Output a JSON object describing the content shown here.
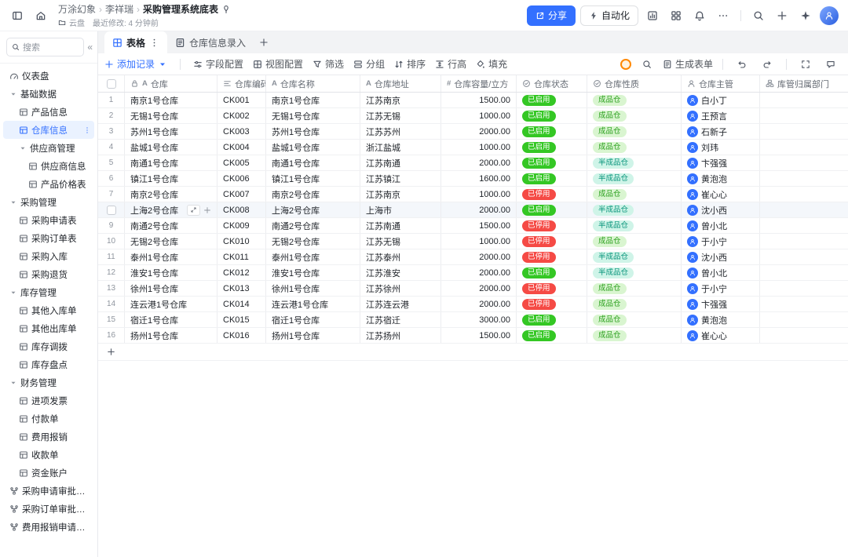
{
  "colors": {
    "accent": "#3370FF",
    "status_enabled": "#34C724",
    "status_disabled": "#F54A45",
    "nature_finished_bg": "#D9F5D0",
    "nature_finished_text": "#2EA121",
    "nature_semi_bg": "#CFF4E8",
    "nature_semi_text": "#0A957C"
  },
  "topbar": {
    "breadcrumb": [
      "万涂幻象",
      "李祥瑞",
      "采购管理系统底表"
    ],
    "drive_label": "云盘",
    "modified_label": "最近修改: 4 分钟前",
    "share_label": "分享",
    "automation_label": "自动化"
  },
  "sidebar": {
    "search_placeholder": "搜索",
    "items": [
      {
        "label": "仪表盘",
        "level": 0,
        "type": "leaf",
        "icon": "gauge"
      },
      {
        "label": "基础数据",
        "level": 0,
        "type": "group"
      },
      {
        "label": "产品信息",
        "level": 1,
        "type": "leaf",
        "icon": "tableicon"
      },
      {
        "label": "仓库信息",
        "level": 1,
        "type": "leaf",
        "icon": "tableicon",
        "active": true
      },
      {
        "label": "供应商管理",
        "level": 1,
        "type": "group"
      },
      {
        "label": "供应商信息",
        "level": 2,
        "type": "leaf",
        "icon": "tableicon"
      },
      {
        "label": "产品价格表",
        "level": 2,
        "type": "leaf",
        "icon": "tableicon"
      },
      {
        "label": "采购管理",
        "level": 0,
        "type": "group"
      },
      {
        "label": "采购申请表",
        "level": 1,
        "type": "leaf",
        "icon": "tableicon"
      },
      {
        "label": "采购订单表",
        "level": 1,
        "type": "leaf",
        "icon": "tableicon"
      },
      {
        "label": "采购入库",
        "level": 1,
        "type": "leaf",
        "icon": "tableicon"
      },
      {
        "label": "采购退货",
        "level": 1,
        "type": "leaf",
        "icon": "tableicon"
      },
      {
        "label": "库存管理",
        "level": 0,
        "type": "group"
      },
      {
        "label": "其他入库单",
        "level": 1,
        "type": "leaf",
        "icon": "tableicon"
      },
      {
        "label": "其他出库单",
        "level": 1,
        "type": "leaf",
        "icon": "tableicon"
      },
      {
        "label": "库存调拨",
        "level": 1,
        "type": "leaf",
        "icon": "tableicon"
      },
      {
        "label": "库存盘点",
        "level": 1,
        "type": "leaf",
        "icon": "tableicon"
      },
      {
        "label": "财务管理",
        "level": 0,
        "type": "group"
      },
      {
        "label": "进项发票",
        "level": 1,
        "type": "leaf",
        "icon": "tableicon"
      },
      {
        "label": "付款单",
        "level": 1,
        "type": "leaf",
        "icon": "tableicon"
      },
      {
        "label": "费用报销",
        "level": 1,
        "type": "leaf",
        "icon": "tableicon"
      },
      {
        "label": "收款单",
        "level": 1,
        "type": "leaf",
        "icon": "tableicon"
      },
      {
        "label": "资金账户",
        "level": 1,
        "type": "leaf",
        "icon": "tableicon"
      },
      {
        "label": "采购申请审批结果...",
        "level": 0,
        "type": "leaf",
        "icon": "workflow"
      },
      {
        "label": "采购订单审批结果...",
        "level": 0,
        "type": "leaf",
        "icon": "workflow"
      },
      {
        "label": "费用报销申请结果...",
        "level": 0,
        "type": "leaf",
        "icon": "workflow"
      }
    ]
  },
  "view_tabs": {
    "tabs": [
      {
        "label": "表格",
        "active": true,
        "icon": "grid"
      },
      {
        "label": "仓库信息录入",
        "active": false,
        "icon": "formdoc"
      }
    ]
  },
  "toolbar": {
    "left": [
      {
        "label": "添加记录",
        "icon": "plus",
        "primary": true
      },
      {
        "label": "字段配置",
        "icon": "sliders"
      },
      {
        "label": "视图配置",
        "icon": "grid"
      },
      {
        "label": "筛选",
        "icon": "filter"
      },
      {
        "label": "分组",
        "icon": "grouping"
      },
      {
        "label": "排序",
        "icon": "sort"
      },
      {
        "label": "行高",
        "icon": "rowheight"
      },
      {
        "label": "填充",
        "icon": "fillicon"
      }
    ],
    "generate_form": "生成表单"
  },
  "table": {
    "type_glyphs": {
      "text": "A",
      "number": "#"
    },
    "columns": [
      {
        "label": "仓库",
        "type": "primary"
      },
      {
        "label": "仓库编码",
        "type": "lines"
      },
      {
        "label": "仓库名称",
        "type": "text"
      },
      {
        "label": "仓库地址",
        "type": "text"
      },
      {
        "label": "仓库容量/立方",
        "type": "number"
      },
      {
        "label": "仓库状态",
        "type": "select"
      },
      {
        "label": "仓库性质",
        "type": "select"
      },
      {
        "label": "仓库主管",
        "type": "person"
      },
      {
        "label": "库管归属部门",
        "type": "department"
      }
    ],
    "rows": [
      {
        "n": "1",
        "warehouse": "南京1号仓库",
        "code": "CK001",
        "name": "南京1号仓库",
        "address": "江苏南京",
        "capacity": "1500.00",
        "status": "已启用",
        "status_kind": "enabled",
        "nature": "成品仓",
        "nature_kind": "finished",
        "manager": "白小丁"
      },
      {
        "n": "2",
        "warehouse": "无锡1号仓库",
        "code": "CK002",
        "name": "无锡1号仓库",
        "address": "江苏无锡",
        "capacity": "1000.00",
        "status": "已启用",
        "status_kind": "enabled",
        "nature": "成品仓",
        "nature_kind": "finished",
        "manager": "王预言"
      },
      {
        "n": "3",
        "warehouse": "苏州1号仓库",
        "code": "CK003",
        "name": "苏州1号仓库",
        "address": "江苏苏州",
        "capacity": "2000.00",
        "status": "已启用",
        "status_kind": "enabled",
        "nature": "成品仓",
        "nature_kind": "finished",
        "manager": "石新子"
      },
      {
        "n": "4",
        "warehouse": "盐城1号仓库",
        "code": "CK004",
        "name": "盐城1号仓库",
        "address": "浙江盐城",
        "capacity": "1000.00",
        "status": "已启用",
        "status_kind": "enabled",
        "nature": "成品仓",
        "nature_kind": "finished",
        "manager": "刘玮"
      },
      {
        "n": "5",
        "warehouse": "南通1号仓库",
        "code": "CK005",
        "name": "南通1号仓库",
        "address": "江苏南通",
        "capacity": "2000.00",
        "status": "已启用",
        "status_kind": "enabled",
        "nature": "半成品仓",
        "nature_kind": "semi",
        "manager": "卞强强"
      },
      {
        "n": "6",
        "warehouse": "镇江1号仓库",
        "code": "CK006",
        "name": "镇江1号仓库",
        "address": "江苏镇江",
        "capacity": "1600.00",
        "status": "已启用",
        "status_kind": "enabled",
        "nature": "半成品仓",
        "nature_kind": "semi",
        "manager": "黄泡泡"
      },
      {
        "n": "7",
        "warehouse": "南京2号仓库",
        "code": "CK007",
        "name": "南京2号仓库",
        "address": "江苏南京",
        "capacity": "1000.00",
        "status": "已停用",
        "status_kind": "disabled",
        "nature": "成品仓",
        "nature_kind": "finished",
        "manager": "崔心心"
      },
      {
        "n": "8",
        "warehouse": "上海2号仓库",
        "code": "CK008",
        "name": "上海2号仓库",
        "address": "上海市",
        "capacity": "2000.00",
        "status": "已启用",
        "status_kind": "enabled",
        "nature": "半成品仓",
        "nature_kind": "semi",
        "manager": "沈小西",
        "hovered": true
      },
      {
        "n": "9",
        "warehouse": "南通2号仓库",
        "code": "CK009",
        "name": "南通2号仓库",
        "address": "江苏南通",
        "capacity": "1500.00",
        "status": "已停用",
        "status_kind": "disabled",
        "nature": "半成品仓",
        "nature_kind": "semi",
        "manager": "曾小北"
      },
      {
        "n": "10",
        "warehouse": "无锡2号仓库",
        "code": "CK010",
        "name": "无锡2号仓库",
        "address": "江苏无锡",
        "capacity": "1000.00",
        "status": "已停用",
        "status_kind": "disabled",
        "nature": "成品仓",
        "nature_kind": "finished",
        "manager": "于小宁"
      },
      {
        "n": "11",
        "warehouse": "泰州1号仓库",
        "code": "CK011",
        "name": "泰州1号仓库",
        "address": "江苏泰州",
        "capacity": "2000.00",
        "status": "已停用",
        "status_kind": "disabled",
        "nature": "半成品仓",
        "nature_kind": "semi",
        "manager": "沈小西"
      },
      {
        "n": "12",
        "warehouse": "淮安1号仓库",
        "code": "CK012",
        "name": "淮安1号仓库",
        "address": "江苏淮安",
        "capacity": "2000.00",
        "status": "已启用",
        "status_kind": "enabled",
        "nature": "半成品仓",
        "nature_kind": "semi",
        "manager": "曾小北"
      },
      {
        "n": "13",
        "warehouse": "徐州1号仓库",
        "code": "CK013",
        "name": "徐州1号仓库",
        "address": "江苏徐州",
        "capacity": "2000.00",
        "status": "已停用",
        "status_kind": "disabled",
        "nature": "成品仓",
        "nature_kind": "finished",
        "manager": "于小宁"
      },
      {
        "n": "14",
        "warehouse": "连云港1号仓库",
        "code": "CK014",
        "name": "连云港1号仓库",
        "address": "江苏连云港",
        "capacity": "2000.00",
        "status": "已停用",
        "status_kind": "disabled",
        "nature": "成品仓",
        "nature_kind": "finished",
        "manager": "卞强强"
      },
      {
        "n": "15",
        "warehouse": "宿迁1号仓库",
        "code": "CK015",
        "name": "宿迁1号仓库",
        "address": "江苏宿迁",
        "capacity": "3000.00",
        "status": "已启用",
        "status_kind": "enabled",
        "nature": "成品仓",
        "nature_kind": "finished",
        "manager": "黄泡泡"
      },
      {
        "n": "16",
        "warehouse": "扬州1号仓库",
        "code": "CK016",
        "name": "扬州1号仓库",
        "address": "江苏扬州",
        "capacity": "1500.00",
        "status": "已启用",
        "status_kind": "enabled",
        "nature": "成品仓",
        "nature_kind": "finished",
        "manager": "崔心心"
      }
    ]
  }
}
